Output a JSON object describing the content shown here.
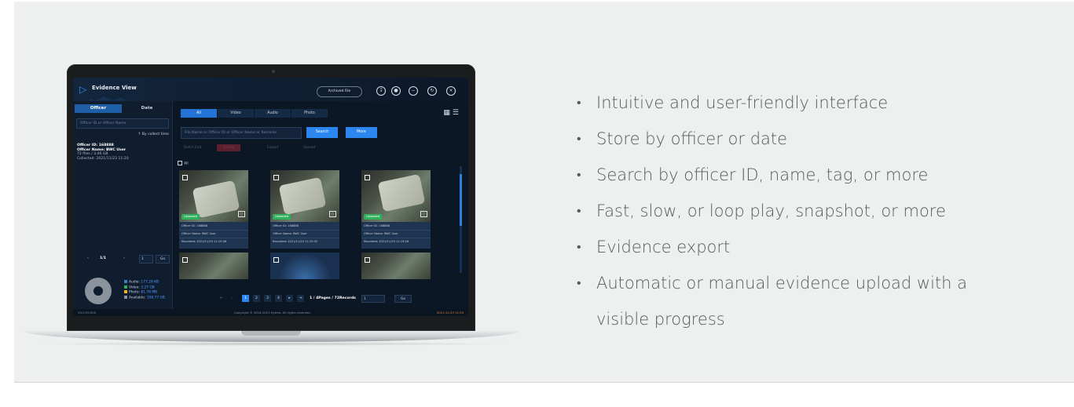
{
  "app": {
    "title": "Evidence View",
    "archived_button": "Archived File",
    "window_icons": [
      "download-icon",
      "user-icon",
      "minimize-icon",
      "refresh-icon",
      "close-icon"
    ]
  },
  "left": {
    "tabs": [
      "Officer",
      "Date"
    ],
    "search_placeholder": "Officer ID or Officer Name",
    "sort_label": "By collect time",
    "officer": {
      "id": "Officer ID: 168888",
      "name": "Officer Name: BWC User",
      "files": "72 files / 3.46  GB",
      "collected": "Collected: 2021/11/23 11:20"
    },
    "pager": {
      "page": "1/1",
      "input": "1",
      "go": "Go"
    },
    "storage": [
      {
        "label": "Audio:",
        "value": "177.28  KB",
        "color": "#3a7bd5"
      },
      {
        "label": "Video:",
        "value": "3.27  GB",
        "color": "#2fb05a"
      },
      {
        "label": "Photo:",
        "value": "81.76  MB",
        "color": "#f0b323"
      },
      {
        "label": "Available:",
        "value": "108.77  GB",
        "color": "#8a929c"
      }
    ]
  },
  "main": {
    "tabs": [
      "All",
      "Video",
      "Audio",
      "Photo"
    ],
    "search_placeholder": "File Name or Officer ID or Officer Name or Remarks",
    "search_button": "Search",
    "more_button": "More",
    "actions": [
      "Batch Edit",
      "Delete",
      "Export",
      "Upload"
    ],
    "select_all": "All",
    "cards": [
      {
        "status": "Uploaded",
        "officer_id": "Officer ID: 168888",
        "officer_name": "Officer Name: BWC User",
        "recorded": "Recorded: 2021/11/23 11:19:36"
      },
      {
        "status": "Uploaded",
        "officer_id": "Officer ID: 168888",
        "officer_name": "Officer Name: BWC User",
        "recorded": "Recorded: 2021/11/23 11:19:32"
      },
      {
        "status": "Uploaded",
        "officer_id": "Officer ID: 168888",
        "officer_name": "Officer Name: BWC User",
        "recorded": "Recorded: 2021/11/23 11:19:28"
      }
    ],
    "pagination": {
      "pages": [
        "1",
        "2",
        "3",
        "4"
      ],
      "summary": "1 / 4Pages / 72Records",
      "input": "1",
      "go": "Go"
    }
  },
  "status": {
    "version": "V4.0.09.000",
    "copyright": "Copyright © 2016-2021 Hytera. All rights reserved.",
    "time": "2021-11-23 11:29"
  },
  "features": [
    "Intuitive and user-friendly interface",
    "Store by officer or date",
    "Search by officer ID, name, tag, or more",
    "Fast, slow, or loop play, snapshot, or more",
    "Evidence export",
    "Automatic or manual evidence upload with a",
    "visible progress"
  ]
}
